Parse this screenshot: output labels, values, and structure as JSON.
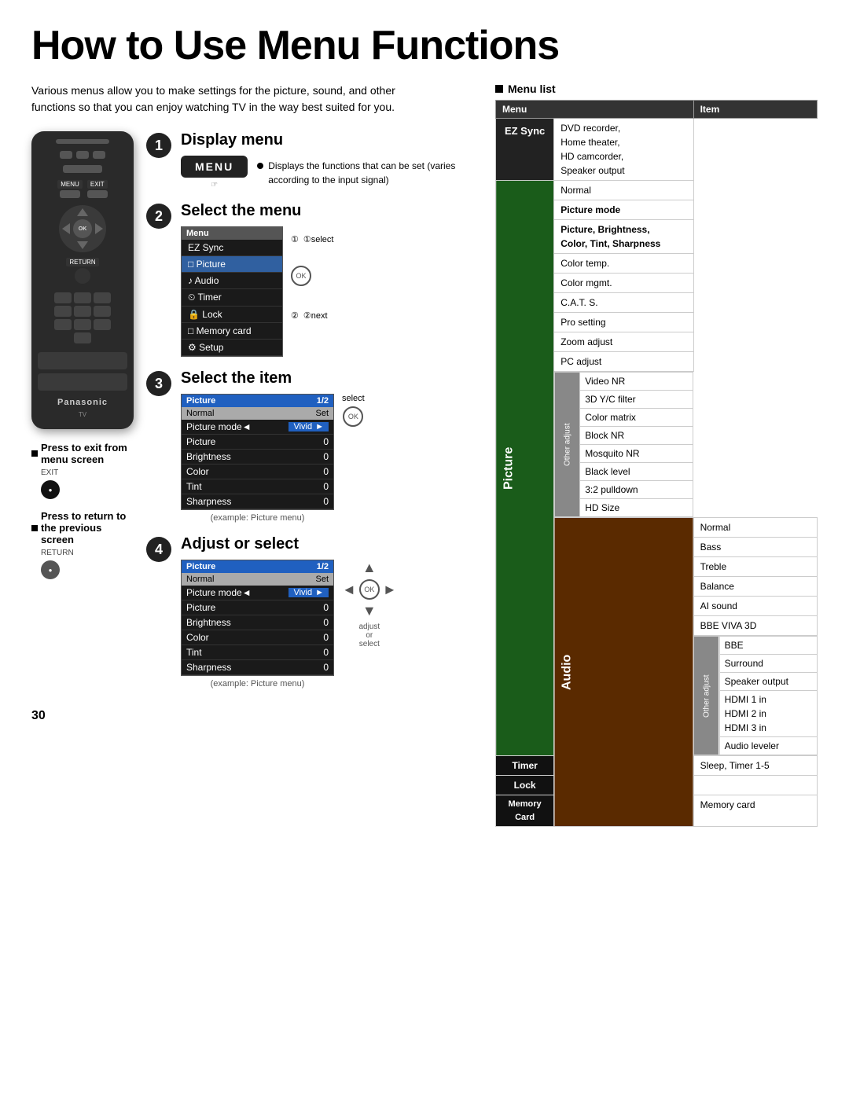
{
  "page": {
    "title": "How to Use Menu Functions",
    "page_number": "30",
    "intro": "Various menus allow you to make settings for the picture, sound, and other functions so that you can enjoy watching TV in the way best suited for you."
  },
  "steps": [
    {
      "number": "1",
      "title": "Display menu",
      "menu_btn": "MENU",
      "note_bullet": "Displays the functions that can be set (varies according to the input signal)"
    },
    {
      "number": "2",
      "title": "Select the menu",
      "select_label": "①select",
      "next_label": "②next",
      "menu_header": "Menu",
      "menu_items": [
        "EZ Sync",
        "□ Picture",
        "♪ Audio",
        "⏲ Timer",
        "🔒 Lock",
        "□ Memory card",
        "⚙ Setup"
      ]
    },
    {
      "number": "3",
      "title": "Select the item",
      "select_label": "select",
      "picture_header": "Picture",
      "picture_page": "1/2",
      "picture_subheader_left": "Normal",
      "picture_subheader_right": "Set",
      "picture_rows": [
        {
          "label": "Picture mode◄",
          "value": "Vivid ►"
        },
        {
          "label": "Picture",
          "value": "0"
        },
        {
          "label": "Brightness",
          "value": "0"
        },
        {
          "label": "Color",
          "value": "0"
        },
        {
          "label": "Tint",
          "value": "0"
        },
        {
          "label": "Sharpness",
          "value": "0"
        }
      ],
      "example_label": "(example: Picture menu)"
    },
    {
      "number": "4",
      "title": "Adjust or select",
      "adjust_label": "adjust\nor\nselect",
      "picture_header": "Picture",
      "picture_page": "1/2",
      "picture_subheader_left": "Normal",
      "picture_subheader_right": "Set",
      "picture_rows": [
        {
          "label": "Picture mode◄",
          "value": "Vivid ►"
        },
        {
          "label": "Picture",
          "value": "0"
        },
        {
          "label": "Brightness",
          "value": "0"
        },
        {
          "label": "Color",
          "value": "0"
        },
        {
          "label": "Tint",
          "value": "0"
        },
        {
          "label": "Sharpness",
          "value": "0"
        }
      ],
      "example_label": "(example: Picture menu)"
    }
  ],
  "press_notes": [
    {
      "title": "Press to exit from menu screen",
      "label": "EXIT"
    },
    {
      "title": "Press to return to the previous screen",
      "label": "RETURN"
    }
  ],
  "menu_list": {
    "title": "Menu list",
    "headers": [
      "Menu",
      "Item"
    ],
    "categories": [
      {
        "name": "EZ Sync",
        "items": [
          "DVD recorder, Home theater, HD camcorder, Speaker output"
        ]
      },
      {
        "name": "Picture",
        "items_grouped": [
          {
            "label": "Normal",
            "sub": false
          },
          {
            "label": "Picture mode",
            "sub": false
          },
          {
            "label": "Picture, Brightness, Color, Tint, Sharpness",
            "sub": false,
            "bold": true
          },
          {
            "label": "Color temp.",
            "sub": false
          },
          {
            "label": "Color mgmt.",
            "sub": false
          },
          {
            "label": "C.A.T. S.",
            "sub": false
          },
          {
            "label": "Pro setting",
            "sub": false
          },
          {
            "label": "Zoom adjust",
            "sub": false
          },
          {
            "label": "PC adjust",
            "sub": false
          },
          {
            "sub_adj": "Other adjust",
            "sub_items": [
              "Video NR",
              "3D Y/C filter",
              "Color matrix",
              "Block NR",
              "Mosquito NR",
              "Black level",
              "3:2 pulldown",
              "HD Size"
            ]
          }
        ]
      },
      {
        "name": "Audio",
        "items_grouped": [
          {
            "label": "Normal",
            "sub": false
          },
          {
            "label": "Bass",
            "sub": false
          },
          {
            "label": "Treble",
            "sub": false
          },
          {
            "label": "Balance",
            "sub": false
          },
          {
            "label": "AI sound",
            "sub": false
          },
          {
            "label": "BBE VIVA 3D",
            "sub": false
          },
          {
            "sub_adj": "Other adjust",
            "sub_items": [
              "BBE",
              "Surround",
              "Speaker output",
              "HDMI 1 in\nHDMI 2 in\nHDMI 3 in",
              "Audio leveler"
            ]
          }
        ]
      },
      {
        "name": "Timer",
        "items": [
          "Sleep, Timer 1-5"
        ]
      },
      {
        "name": "Lock",
        "items": []
      },
      {
        "name": "Memory Card",
        "items": [
          "Memory card"
        ]
      }
    ]
  },
  "remote": {
    "brand": "Panasonic",
    "type": "TV",
    "menu_label": "MENU",
    "exit_label": "EXIT",
    "return_label": "RETURN",
    "ok_label": "OK"
  }
}
